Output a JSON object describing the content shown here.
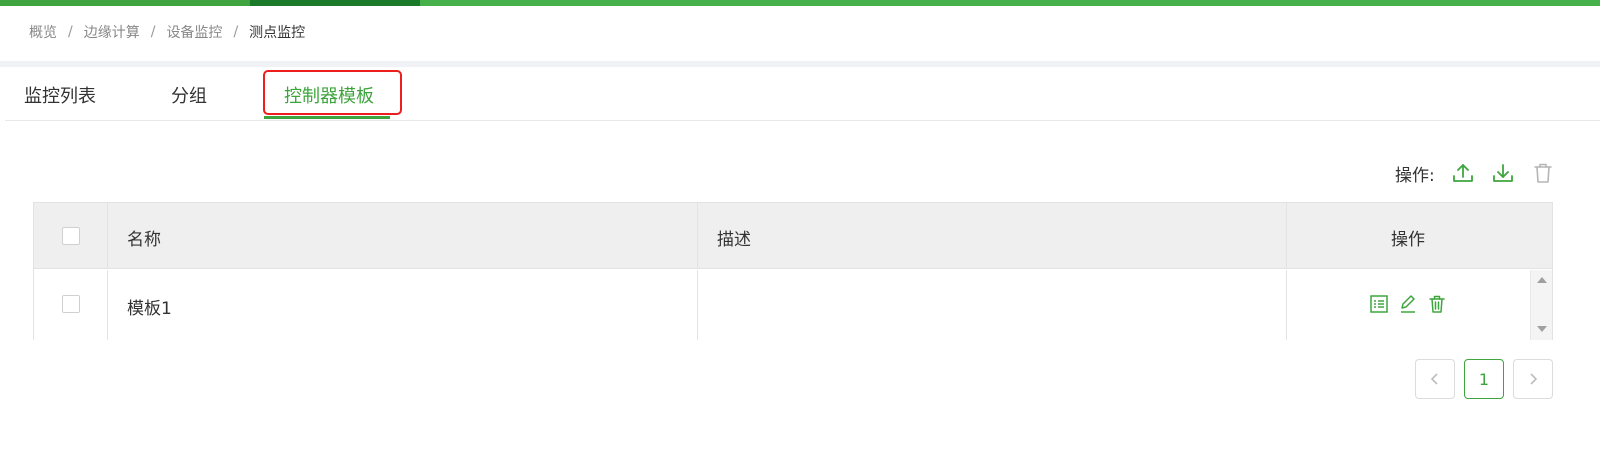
{
  "breadcrumb": {
    "items": [
      "概览",
      "边缘计算",
      "设备监控"
    ],
    "current": "测点监控",
    "separator": "/"
  },
  "tabs": [
    {
      "label": "监控列表"
    },
    {
      "label": "分组"
    },
    {
      "label": "控制器模板",
      "active": true
    }
  ],
  "toolbar": {
    "ops_label": "操作:",
    "icons": [
      "upload-icon",
      "download-icon",
      "trash-icon"
    ]
  },
  "table": {
    "headers": [
      "名称",
      "描述",
      "操作"
    ],
    "rows": [
      {
        "name": "模板1",
        "description": "",
        "actions": [
          "detail-icon",
          "edit-icon",
          "delete-icon"
        ]
      }
    ]
  },
  "pagination": {
    "current_page": "1"
  },
  "colors": {
    "accent": "#3ea53e",
    "highlight_box": "#ee1e1e"
  }
}
